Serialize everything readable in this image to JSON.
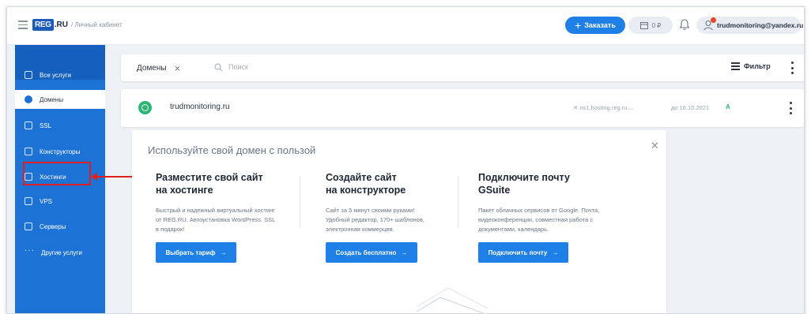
{
  "header": {
    "logo_reg": "REG",
    "logo_ru": ".RU",
    "logo_sub": "/ Личный кабинет",
    "order_label": "Заказать",
    "balance": "0 ₽",
    "user_email": "trudmonitoring@yandex.ru"
  },
  "sidebar": {
    "items": [
      {
        "label": "Все услуги",
        "icon": "list-icon"
      },
      {
        "label": "Домены",
        "icon": "globe-icon"
      },
      {
        "label": "SSL",
        "icon": "lock-icon"
      },
      {
        "label": "Конструкторы",
        "icon": "builder-icon"
      },
      {
        "label": "Хостинги",
        "icon": "hosting-icon"
      },
      {
        "label": "VPS",
        "icon": "server-icon"
      },
      {
        "label": "Серверы",
        "icon": "server-rack-icon"
      },
      {
        "label": "Другие услуги",
        "icon": "more-icon"
      }
    ]
  },
  "toolbar": {
    "filter_chip": "Домены",
    "search_placeholder": "Поиск",
    "filter_label": "Фильтр"
  },
  "domain_row": {
    "name": "trudmonitoring.ru",
    "dns": "ns1.hosting.reg.ru ...",
    "until": "до 16.10.2021",
    "status": "A"
  },
  "promo": {
    "title": "Используйте свой домен с пользой",
    "cards": [
      {
        "title_1": "Разместите свой сайт",
        "title_2": "на хостинге",
        "text_1": "Быстрый и надежный виртуальный хостинг",
        "text_2": "от REG.RU. Автоустановка WordPress. SSL",
        "text_3": "в подарок!",
        "button": "Выбрать тариф"
      },
      {
        "title_1": "Создайте сайт",
        "title_2": "на конструкторе",
        "text_1": "Сайт за 5 минут своими руками!",
        "text_2": "Удобный редактор, 170+ шаблонов,",
        "text_3": "электронная коммерция.",
        "button": "Создать бесплатно"
      },
      {
        "title_1": "Подключите почту",
        "title_2": "GSuite",
        "text_1": "Пакет облачных сервисов от Google. Почта,",
        "text_2": "видеоконференции, совместная работа с",
        "text_3": "документами, календарь.",
        "button": "Подключить почту"
      }
    ]
  },
  "colors": {
    "sidebar": "#1d72d6",
    "accent": "#1e7fe6",
    "success": "#2bb673",
    "annotation": "#e02020"
  }
}
